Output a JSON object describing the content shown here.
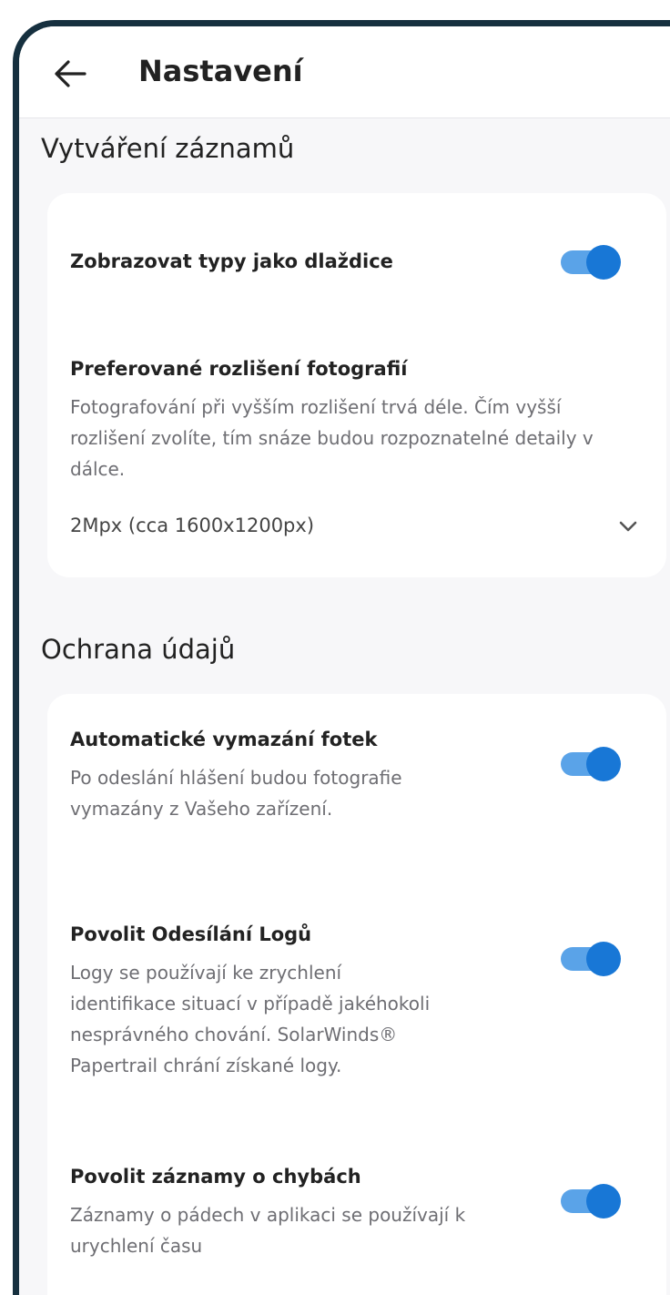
{
  "header": {
    "title": "Nastavení",
    "back_icon": "arrow-left-icon"
  },
  "accent_color": "#1877d6",
  "sections": [
    {
      "title": "Vytváření záznamů",
      "items": [
        {
          "title": "Zobrazovat typy jako dlaždice",
          "toggle_on": true
        },
        {
          "title": "Preferované rozlišení fotografií",
          "description": "Fotografování při vyšším rozlišení trvá déle. Čím vyšší rozlišení zvolíte, tím snáze budou rozpoznatelné detaily v dálce.",
          "select_value": "2Mpx (cca 1600x1200px)",
          "select_icon": "chevron-down-icon"
        }
      ]
    },
    {
      "title": "Ochrana údajů",
      "items": [
        {
          "title": "Automatické vymazání fotek",
          "description": "Po odeslání hlášení budou fotografie vymazány z Vašeho zařízení.",
          "toggle_on": true
        },
        {
          "title": "Povolit Odesílání Logů",
          "description": "Logy se používají ke zrychlení identifikace situací v případě jakéhokoli nesprávného chování. SolarWinds® Papertrail chrání získané logy.",
          "toggle_on": true
        },
        {
          "title": "Povolit záznamy o chybách",
          "description": "Záznamy o pádech v aplikaci se používají k urychlení času",
          "toggle_on": true
        }
      ]
    }
  ]
}
